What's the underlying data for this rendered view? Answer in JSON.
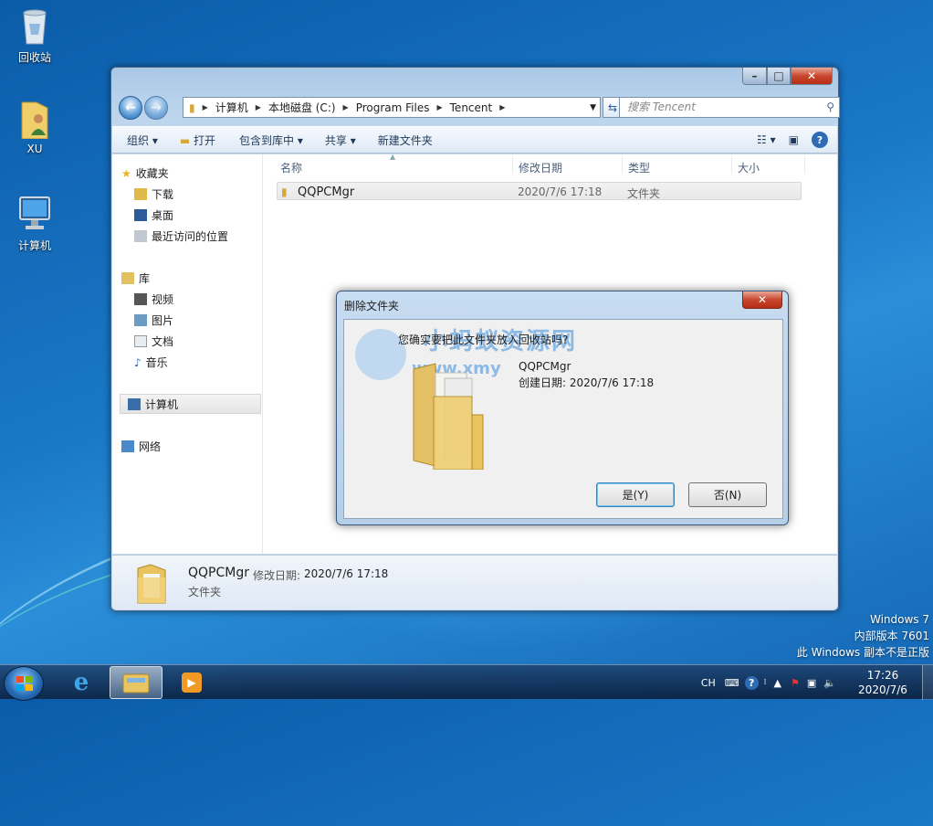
{
  "desktop": {
    "icons": [
      {
        "label": "回收站"
      },
      {
        "label": "XU"
      },
      {
        "label": "计算机"
      }
    ],
    "watermark": [
      "Windows 7",
      "内部版本 7601",
      "此 Windows 副本不是正版"
    ]
  },
  "explorer": {
    "breadcrumb": [
      "计算机",
      "本地磁盘 (C:)",
      "Program Files",
      "Tencent"
    ],
    "search_placeholder": "搜索 Tencent",
    "toolbar": {
      "organize": "组织",
      "open": "打开",
      "include": "包含到库中",
      "share": "共享",
      "new_folder": "新建文件夹"
    },
    "nav": {
      "favorites": "收藏夹",
      "downloads": "下载",
      "desktop": "桌面",
      "recent": "最近访问的位置",
      "libraries": "库",
      "videos": "视频",
      "pictures": "图片",
      "documents": "文档",
      "music": "音乐",
      "computer": "计算机",
      "network": "网络"
    },
    "columns": [
      "名称",
      "修改日期",
      "类型",
      "大小"
    ],
    "files": [
      {
        "name": "QQPCMgr",
        "date": "2020/7/6 17:18",
        "type": "文件夹",
        "size": ""
      }
    ],
    "details": {
      "name": "QQPCMgr",
      "date_label": "修改日期:",
      "date": "2020/7/6 17:18",
      "type": "文件夹"
    }
  },
  "dialog": {
    "title": "删除文件夹",
    "message": "您确实要把此文件夹放入回收站吗?",
    "item_name": "QQPCMgr",
    "created": "创建日期: 2020/7/6 17:18",
    "yes": "是(Y)",
    "no": "否(N)",
    "overlay_text": "小蚂蚁资源网",
    "overlay_url": "www.xmy"
  },
  "taskbar": {
    "ime": "CH",
    "time": "17:26",
    "date": "2020/7/6"
  }
}
